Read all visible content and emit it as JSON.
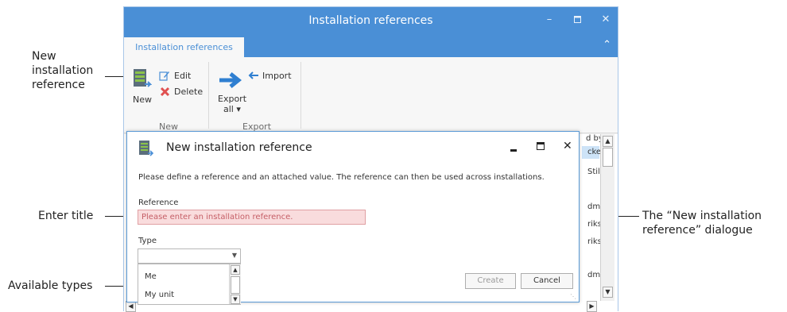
{
  "callouts": {
    "new_ref": [
      "New",
      "installation",
      "reference"
    ],
    "enter_title": "Enter title",
    "available_types": "Available types",
    "dialog_desc": [
      "The “New installation",
      "reference” dialogue"
    ]
  },
  "window": {
    "title": "Installation references",
    "tab": "Installation references"
  },
  "ribbon": {
    "new_label": "New",
    "edit_label": "Edit",
    "delete_label": "Delete",
    "export_label_1": "Export",
    "export_label_2": "all ▾",
    "import_label": "Import",
    "group_new": "New",
    "group_export": "Export"
  },
  "grid": {
    "header_fragment": "d by",
    "rows": [
      "cke",
      "Still",
      "dmı",
      "riks:",
      "riks:",
      "dmı"
    ]
  },
  "dialog": {
    "title": "New installation reference",
    "description": "Please define a reference and an attached value. The reference can then be used across installations.",
    "reference_label": "Reference",
    "reference_placeholder": "Please enter an installation reference.",
    "type_label": "Type",
    "type_options": [
      "Me",
      "My unit"
    ],
    "create_label": "Create",
    "cancel_label": "Cancel"
  }
}
